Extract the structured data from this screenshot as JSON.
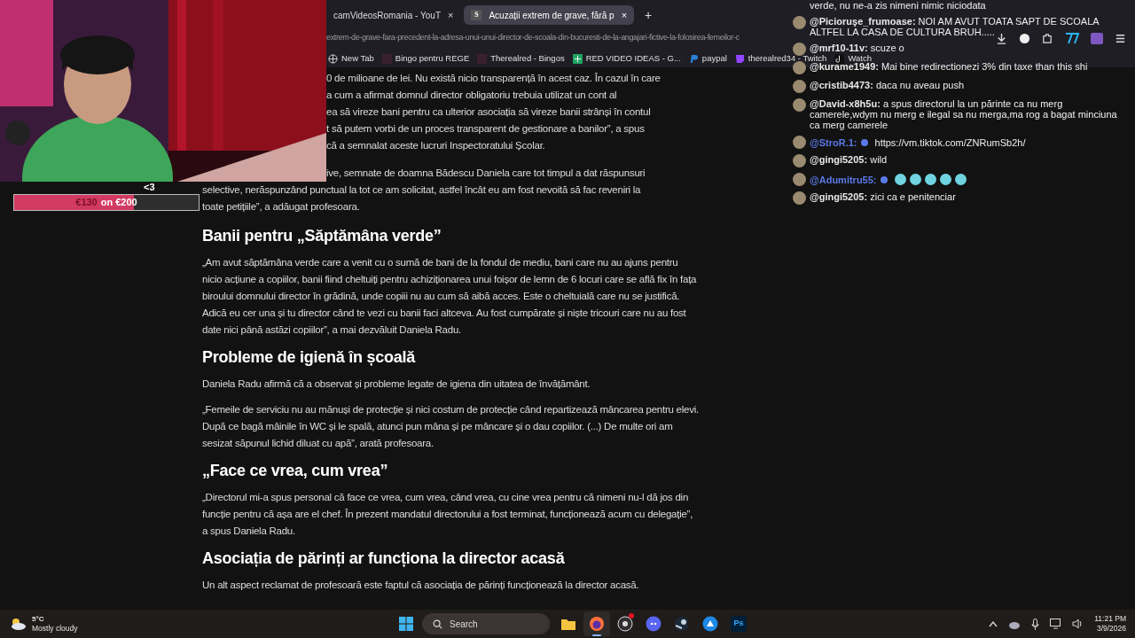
{
  "browser": {
    "tabs": [
      {
        "title": "camVideosRomania - YouT",
        "close": "×",
        "selected": false
      },
      {
        "site_icon": "S",
        "title": "Acuzații extrem de grave, fără p",
        "close": "×",
        "selected": true
      }
    ],
    "new_tab": "+",
    "url": "extrem-de-grave-fara-precedent-la-adresa-unui-unui-director-de-scoala-din-bucuresti-de-la-angajari-fictive-la-folosirea-femeilor-c",
    "bookmarks": [
      {
        "label": "New Tab",
        "kind": "globe"
      },
      {
        "label": "Bingo pentru REGE",
        "kind": "thumb"
      },
      {
        "label": "Therealred - Bingos",
        "kind": "thumb"
      },
      {
        "label": "RED VIDEO IDEAS - G...",
        "kind": "sheet"
      },
      {
        "label": "paypal",
        "kind": "paypal"
      },
      {
        "label": "therealred34 - Twitch",
        "kind": "twitch"
      },
      {
        "label": "Watch",
        "kind": "tiktok"
      }
    ]
  },
  "article": {
    "partial_paragraphs": [
      {
        "beside_webcam": [
          "0 de milioane de lei. Nu există nicio transparență în acest caz. În cazul în care",
          "a cum a afirmat domnul director obligatoriu trebuia utilizat un cont al",
          "ea să vireze bani pentru ca ulterior asociația să vireze banii strânși în contul",
          "t să putem vorbi de un proces transparent de gestionare a banilor”, a spus",
          "că a semnalat aceste lucruri Inspectoratului Școlar."
        ]
      },
      {
        "beside_webcam": [
          "ive, semnate de doamna Bădescu Daniela care tot timpul a dat răspunsuri"
        ],
        "lines": [
          "selective, nerăspunzând punctual la tot ce am solicitat, astfel încât eu am fost nevoită să fac reveniri la",
          "toate petițiile”, a adăugat profesoara."
        ]
      }
    ],
    "blocks": [
      {
        "kind": "heading",
        "text": "Banii pentru „Săptămâna verde”"
      },
      {
        "kind": "paragraph",
        "text": "„Am avut săptămâna verde care a venit cu o sumă de bani de la fondul de mediu, bani care nu au ajuns pentru nicio acțiune a copiilor, banii fiind cheltuiți pentru achiziționarea unui foișor de lemn de 6 locuri care se află fix în fața biroului domnului director în grădină, unde copiii nu au cum să aibă acces. Este o cheltuială care nu se justifică. Adică eu cer una și tu director când te vezi cu banii faci altceva. Au fost cumpărate și niște tricouri care nu au fost date nici până astăzi copiilor”, a mai dezvăluit Daniela Radu."
      },
      {
        "kind": "heading",
        "text": "Probleme de igienă în școală"
      },
      {
        "kind": "paragraph",
        "text": "Daniela Radu afirmă că a observat și probleme legate de igiena din uitatea de învățământ."
      },
      {
        "kind": "paragraph",
        "text": "„Femeile de serviciu nu au mănuși de protecție și nici costum de protecție când repartizează mâncarea pentru elevi. După ce bagă mâinile în WC și le spală, atunci pun mâna și pe mâncare și o dau copiilor. (...) De multe ori am sesizat săpunul lichid diluat cu apă”, arată profesoara."
      },
      {
        "kind": "heading",
        "text": "„Face ce vrea, cum vrea”"
      },
      {
        "kind": "paragraph",
        "text": "„Directorul mi-a spus personal că face ce vrea, cum vrea, când vrea, cu cine vrea pentru că nimeni nu-l dă jos din funcție pentru că așa are el chef. În prezent mandatul directorului a fost terminat, funcționează acum cu delegație”, a spus Daniela Radu."
      },
      {
        "kind": "heading",
        "text": "Asociația de părinți ar funcționa la director acasă"
      },
      {
        "kind": "paragraph",
        "text": "Un alt aspect reclamat de profesoară este faptul că asociația de părinți funcționează la director acasă."
      }
    ]
  },
  "donation": {
    "heart": "<3",
    "raised": "€130",
    "goal": "on €200",
    "level": 0.65
  },
  "chat": [
    {
      "kind": "continuation",
      "text": "verde, nu ne-a zis nimeni nimic niciodata"
    },
    {
      "kind": "text",
      "user": "@Picioruşe_frumoase:",
      "text": "NOI AM AVUT TOATA SAPT DE SCOALA ALTFEL LA CASA DE CULTURA BRUH.....",
      "color": "#e8e8e8",
      "badge": false
    },
    {
      "kind": "text",
      "user": "@mrf10-11v:",
      "text": "scuze o",
      "color": "#e8e8e8",
      "badge": false
    },
    {
      "kind": "text",
      "user": "@kurame1949:",
      "text": "Mai bine redirectionezi 3% din taxe than this shi",
      "color": "#e8e8e8",
      "badge": false
    },
    {
      "kind": "text",
      "user": "@cristib4473:",
      "text": "daca nu aveau push",
      "color": "#e8e8e8",
      "badge": false
    },
    {
      "kind": "text",
      "user": "@David-x8h5u:",
      "text": "a spus directorul la un părinte ca nu merg camerele,wdym nu merg e ilegal sa nu merga,ma rog a bagat minciuna ca merg camerele",
      "color": "#e8e8e8",
      "badge": false
    },
    {
      "kind": "text",
      "user": "@StroR.1:",
      "text": "https://vm.tiktok.com/ZNRumSb2h/",
      "color": "#5b79e8",
      "badge": true
    },
    {
      "kind": "text",
      "user": "@gingi5205:",
      "text": "wild",
      "color": "#e8e8e8",
      "badge": false
    },
    {
      "kind": "emotes",
      "user": "@Adumitru55:",
      "color": "#5b79e8",
      "badge": true
    },
    {
      "kind": "text",
      "user": "@gingi5205:",
      "text": "zici ca e penitenciar",
      "color": "#e8e8e8",
      "badge": false
    }
  ],
  "taskbar": {
    "weather": {
      "temp": "5°C",
      "condition": "Mostly cloudy"
    },
    "search": {
      "placeholder": "Search"
    },
    "apps": [
      {
        "kind": "folder",
        "active": false,
        "badge": false
      },
      {
        "kind": "firefox",
        "active": true,
        "badge": false
      },
      {
        "kind": "obs",
        "active": false,
        "badge": true
      },
      {
        "kind": "discord",
        "active": false,
        "badge": false
      },
      {
        "kind": "steam",
        "active": false,
        "badge": false
      },
      {
        "kind": "bluebird",
        "active": false,
        "badge": false
      },
      {
        "kind": "photoshop",
        "active": false,
        "badge": false,
        "label": "Ps"
      }
    ],
    "time": "11:21 PM",
    "date": "3/9/2026"
  }
}
